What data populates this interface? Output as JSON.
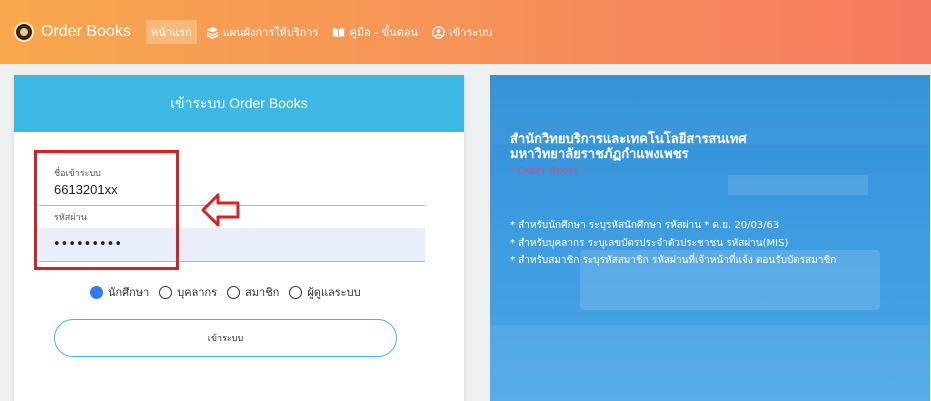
{
  "navbar": {
    "brand": "Order Books",
    "items": [
      {
        "label": "หน้าแรก",
        "icon": "none",
        "active": true
      },
      {
        "label": "แผนผังการให้บริการ",
        "icon": "layers-icon",
        "active": false
      },
      {
        "label": "คู่มือ - ขั้นตอน",
        "icon": "book-icon",
        "active": false
      },
      {
        "label": "เข้าระบบ",
        "icon": "user-circle-icon",
        "active": false
      }
    ]
  },
  "login": {
    "title": "เข้าระบบ Order Books",
    "username_label": "ชื่อเข้าระบบ",
    "username_value": "6613201xx",
    "password_label": "รหัสผ่าน",
    "password_value": "•••••••••",
    "roles": [
      {
        "label": "นักศึกษา",
        "checked": true
      },
      {
        "label": "บุคลากร",
        "checked": false
      },
      {
        "label": "สมาชิก",
        "checked": false
      },
      {
        "label": "ผู้ดูแลระบบ",
        "checked": false
      }
    ],
    "submit_label": "เข้าระบบ"
  },
  "hero": {
    "title_line1": "สำนักวิทยบริการและเทคโนโลยีสารสนเทศ",
    "title_line2": "มหาวิทยาลัยราชภัฏกำแพงเพชร",
    "subtitle": "\" Order Books \"",
    "lines": [
      "* สำหรับนักศึกษา ระบุรหัสนักศึกษา รหัสผ่าน * ด.ย. 20/03/63",
      "* สำหรับบุคลากร ระบุเลขบัตรประจำตัวประชาชน รหัสผ่าน(MIS)",
      "* สำหรับสมาชิก ระบุรหัสสมาชิก รหัสผ่านที่เจ้าหน้าที่แจ้ง ตอนรับบัตรสมาชิก"
    ]
  },
  "colors": {
    "accent": "#3db7e4",
    "annotation": "#d62222",
    "subtitle_pink": "#e8408a"
  }
}
